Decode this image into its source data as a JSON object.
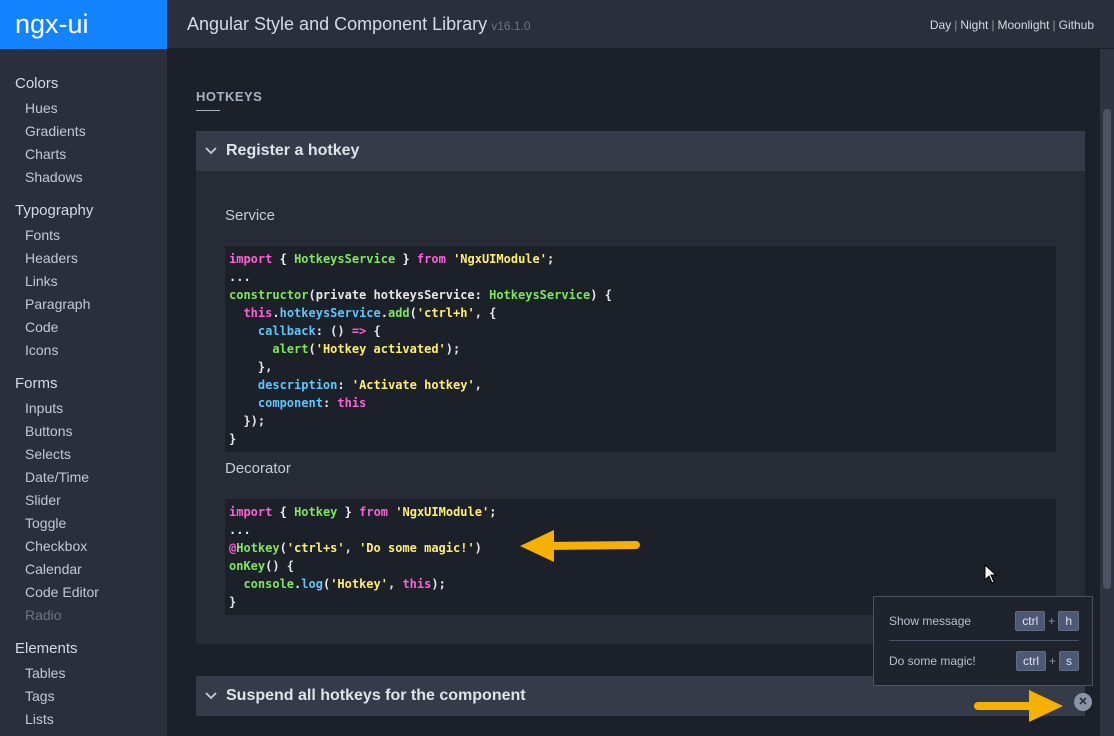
{
  "brand": "ngx-ui",
  "header": {
    "title": "Angular Style and Component Library",
    "version": "v16.1.0",
    "themes": [
      "Day",
      "Night",
      "Moonlight",
      "Github"
    ]
  },
  "sidebar": {
    "groups": [
      {
        "heading": "Colors",
        "items": [
          "Hues",
          "Gradients",
          "Charts",
          "Shadows"
        ]
      },
      {
        "heading": "Typography",
        "items": [
          "Fonts",
          "Headers",
          "Links",
          "Paragraph",
          "Code",
          "Icons"
        ]
      },
      {
        "heading": "Forms",
        "items": [
          "Inputs",
          "Buttons",
          "Selects",
          "Date/Time",
          "Slider",
          "Toggle",
          "Checkbox",
          "Calendar",
          "Code Editor",
          "Radio"
        ]
      },
      {
        "heading": "Elements",
        "items": [
          "Tables",
          "Tags",
          "Lists"
        ]
      }
    ]
  },
  "page": {
    "title": "HOTKEYS",
    "sections": [
      {
        "title": "Register a hotkey"
      },
      {
        "title": "Suspend all hotkeys for the component"
      }
    ],
    "service_label": "Service",
    "decorator_label": "Decorator"
  },
  "hotkeys_panel": {
    "rows": [
      {
        "description": "Show message",
        "keys": [
          "ctrl",
          "h"
        ]
      },
      {
        "description": "Do some magic!",
        "keys": [
          "ctrl",
          "s"
        ]
      }
    ]
  },
  "colors": {
    "brand": "#1483ff",
    "arrow": "#f5b000",
    "keyword": "#ff5fd7",
    "identifier": "#7ee75b",
    "string": "#ffef6e",
    "property": "#5cc6ff"
  },
  "icons": [
    "chevron-down-icon",
    "close-icon",
    "cursor-icon",
    "arrow-icon"
  ]
}
